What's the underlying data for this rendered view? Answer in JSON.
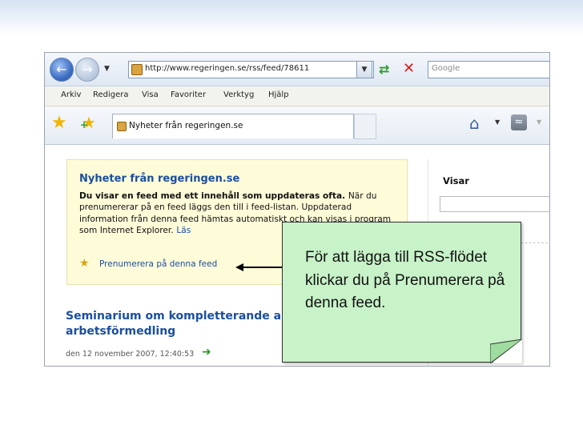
{
  "browser": {
    "address_url": "http://www.regeringen.se/rss/feed/78611",
    "search_placeholder": "Google",
    "menu": [
      "Arkiv",
      "Redigera",
      "Visa",
      "Favoriter",
      "Verktyg",
      "Hjälp"
    ],
    "tab_title": "Nyheter från regeringen.se"
  },
  "feed": {
    "title": "Nyheter från regeringen.se",
    "desc_lead": "Du visar en feed med ett innehåll som uppdateras ofta.",
    "desc_line2": "När du prenumererar på en feed läggs den till i feed-listan. Uppdaterad information från denna feed hämtas automatiskt och kan visas i program som Internet Explorer.",
    "desc_more": "Läs",
    "subscribe_label": "Prenumerera på denna feed"
  },
  "side": {
    "title": "Visar"
  },
  "article": {
    "title": "Seminarium om kompletterande ak arbetsförmedling",
    "date": "den 12 november 2007, 12:40:53"
  },
  "callout": {
    "text": "För att lägga till RSS-flödet klickar du på Prenumerera på denna feed."
  },
  "icons": {
    "back": "back-arrow-icon",
    "forward": "forward-arrow-icon",
    "refresh": "refresh-icon",
    "stop": "stop-icon",
    "favorites": "favorites-star-icon",
    "add_favorite": "add-favorite-icon",
    "home": "home-icon",
    "feeds": "feed-icon",
    "subscribe": "subscribe-star-icon"
  },
  "colors": {
    "link_blue": "#1a4fa0",
    "feed_panel": "#fefbd8",
    "callout_green": "#c8f2c8"
  }
}
